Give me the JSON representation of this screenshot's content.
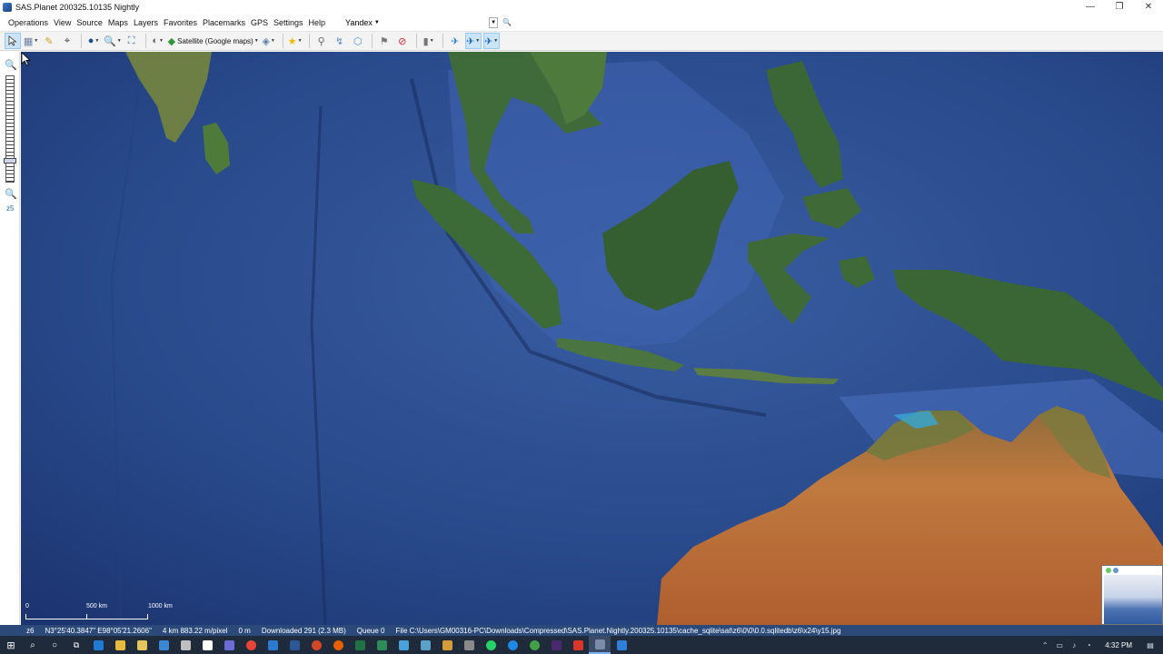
{
  "window": {
    "title": "SAS.Planet 200325.10135 Nightly",
    "controls": [
      "—",
      "❐",
      "✕"
    ]
  },
  "menu": {
    "items": [
      "Operations",
      "View",
      "Source",
      "Maps",
      "Layers",
      "Favorites",
      "Placemarks",
      "GPS",
      "Settings",
      "Help"
    ],
    "search_provider": "Yandex"
  },
  "toolbar": {
    "map_source_label": "Satellite (Google maps)"
  },
  "zoom": {
    "level_label": "z5"
  },
  "scale": {
    "labels": [
      "0",
      "500 km",
      "1000 km"
    ]
  },
  "status": {
    "zoom": "z6",
    "coordinates": "N3°25'40.3847\" E98°05'21.2606\"",
    "resolution": "4 km 883.22 m/pixel",
    "elevation": "0 m",
    "downloaded": "Downloaded 291 (2.3 MB)",
    "queue": "Queue 0",
    "file": "File C:\\Users\\GM00316-PC\\Downloads\\Compressed\\SAS.Planet.Nightly.200325.10135\\cache_sqlite\\sat\\z6\\0\\0\\0.0.sqlitedb\\z6\\x24\\y15.jpg"
  },
  "tray": {
    "time": "4:32 PM"
  },
  "colors": {
    "ocean": "#2a4a8c",
    "land_green": "#3f6a3a",
    "land_desert": "#b8693a",
    "statusbar": "#2b4a7a",
    "taskbar": "#1f2a3a"
  }
}
